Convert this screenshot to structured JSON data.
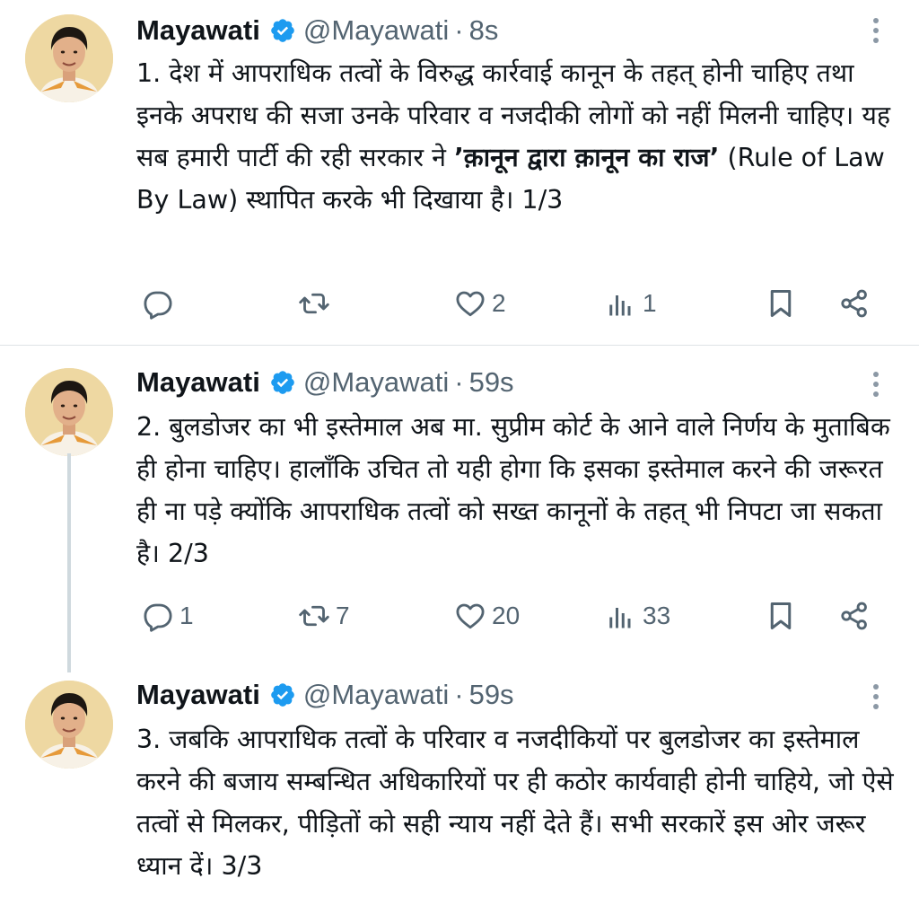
{
  "tweets": [
    {
      "name": "Mayawati",
      "handle": "@Mayawati",
      "separator": "·",
      "time": "8s",
      "text_a": "1. देश में आपराधिक तत्वों के विरुद्ध कार्रवाई कानून के तहत् होनी चाहिए तथा इनके अपराध की सजा उनके परिवार व नजदीकी लोगों को नहीं मिलनी चाहिए। यह सब हमारी पार्टी की रही सरकार ने ",
      "text_bold": "’क़ानून द्वारा क़ानून का राज’",
      "text_b": " (Rule of Law By Law) स्थापित करके भी दिखाया है। 1/3",
      "replies": "",
      "retweets": "",
      "likes": "2",
      "views": "1"
    },
    {
      "name": "Mayawati",
      "handle": "@Mayawati",
      "separator": "·",
      "time": "59s",
      "text": "2. बुलडोजर का भी इस्तेमाल अब मा. सुप्रीम कोर्ट के आने वाले निर्णय के मुताबिक ही होना चाहिए। हालाँकि उचित तो यही होगा कि इसका इस्तेमाल करने की जरूरत ही ना पड़े क्योंकि आपराधिक तत्वों को सख्त कानूनों के तहत् भी निपटा जा सकता है। 2/3",
      "replies": "1",
      "retweets": "7",
      "likes": "20",
      "views": "33"
    },
    {
      "name": "Mayawati",
      "handle": "@Mayawati",
      "separator": "·",
      "time": "59s",
      "text": "3. जबकि आपराधिक तत्वों के परिवार व नजदीकियों पर बुलडोजर का इस्तेमाल करने की बजाय सम्बन्धित अधिकारियों पर ही कठोर कार्यवाही होनी चाहिये, जो ऐसे तत्वों से मिलकर, पीड़ितों को सही न्याय नहीं देते हैं। सभी सरकारें इस ओर जरूर ध्यान दें। 3/3"
    }
  ],
  "icons": {
    "reply": "reply-icon",
    "retweet": "retweet-icon",
    "like": "heart-icon",
    "views": "views-icon",
    "bookmark": "bookmark-icon",
    "share": "share-icon",
    "verified": "verified-badge-icon",
    "more": "more-options-icon"
  },
  "colors": {
    "verified": "#1d9bf0",
    "secondary_text": "#536471",
    "thread_line": "#cfd9de"
  }
}
